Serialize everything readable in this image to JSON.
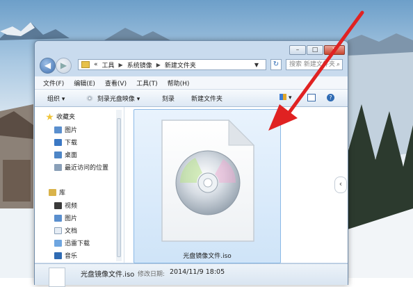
{
  "addressbar": {
    "overflow": "«",
    "crumbs": [
      "工具",
      "系统镜像",
      "新建文件夹"
    ],
    "search_placeholder": "搜索 新建文件夹"
  },
  "menu": [
    "文件(F)",
    "编辑(E)",
    "查看(V)",
    "工具(T)",
    "帮助(H)"
  ],
  "toolbar": {
    "organize": "组织 ▾",
    "burn_image": "刻录光盘映像 ▾",
    "burn": "刻录",
    "new_folder": "新建文件夹"
  },
  "navpane": {
    "favorites": "收藏夹",
    "fav_items": [
      "图片",
      "下载",
      "桌面",
      "最近访问的位置"
    ],
    "libraries": "库",
    "lib_items": [
      "视频",
      "图片",
      "文档",
      "迅雷下载",
      "音乐"
    ]
  },
  "file": {
    "name": "光盘镜像文件.iso"
  },
  "status": {
    "name": "光盘镜像文件.iso",
    "modified_label": "修改日期:",
    "modified_value": "2014/11/9 18:05"
  },
  "colors": {
    "arrow": "#e02222",
    "selection": "#cfe4f8"
  }
}
